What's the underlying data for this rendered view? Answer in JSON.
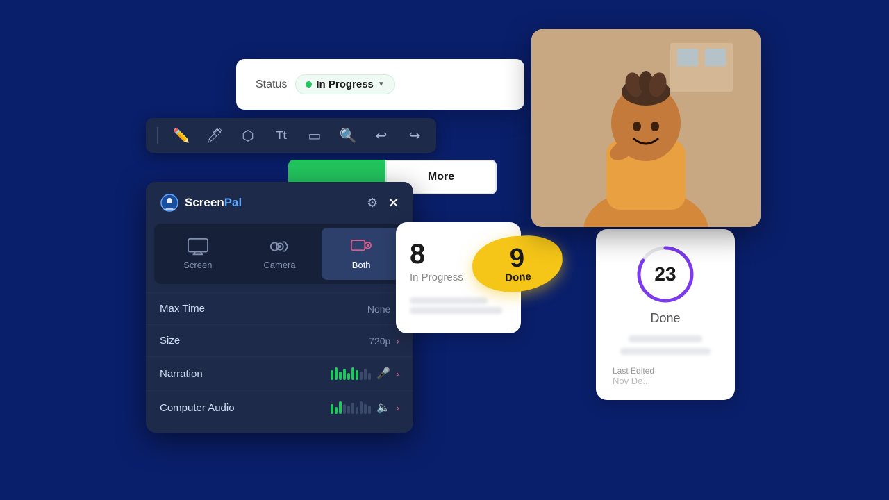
{
  "background_color": "#0a1f6b",
  "status_card": {
    "label": "Status",
    "badge": {
      "text": "In Progress",
      "color": "#22c55e"
    }
  },
  "toolbar": {
    "icons": [
      "pencil",
      "highlight",
      "eraser",
      "text",
      "rectangle",
      "zoom",
      "undo",
      "redo"
    ]
  },
  "more_button": {
    "label": "More"
  },
  "recorder": {
    "logo": "ScreenPal",
    "logo_screen": "Screen",
    "logo_pal": "Pal",
    "modes": [
      {
        "label": "Screen",
        "active": false
      },
      {
        "label": "Camera",
        "active": false
      },
      {
        "label": "Both",
        "active": true
      }
    ],
    "settings": [
      {
        "name": "Max Time",
        "value": "None"
      },
      {
        "name": "Size",
        "value": "720p"
      },
      {
        "name": "Narration",
        "value": ""
      },
      {
        "name": "Computer Audio",
        "value": ""
      }
    ]
  },
  "dashboard": {
    "in_progress_count": "8",
    "in_progress_label": "In Progress",
    "done_badge_count": "9",
    "done_badge_label": "Done",
    "done_circle_count": "23",
    "done_circle_label": "Done",
    "last_edited_label": "Last Edited",
    "last_edited_value": "Nov De..."
  },
  "video_feed": {
    "alt": "Person smiling"
  }
}
